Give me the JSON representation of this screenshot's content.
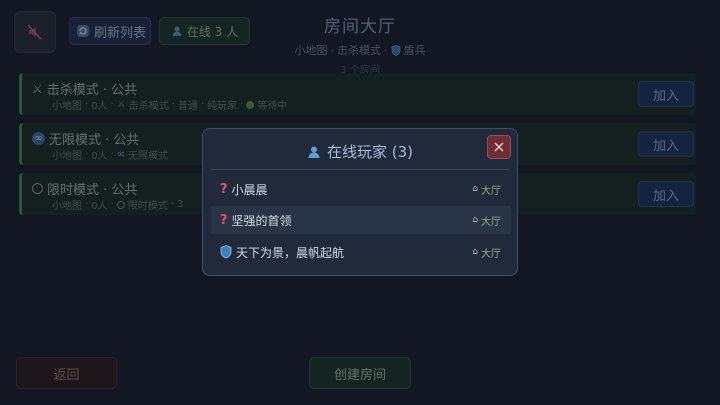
{
  "header": {
    "refresh_label": "刷新列表",
    "online_label": "在线 3 人",
    "title": "房间大厅",
    "sub_map": "小地图",
    "sub_mode": "击杀模式",
    "sub_role": "盾兵",
    "room_count": "3 个房间"
  },
  "rooms": [
    {
      "name": "击杀模式 · 公共",
      "map": "小地图",
      "players": "0人",
      "mode": "击杀模式",
      "difficulty": "普通",
      "type": "纯玩家",
      "status": "等待中",
      "join_label": "加入",
      "icon": "swords-icon"
    },
    {
      "name": "无限模式 · 公共",
      "map": "小地图",
      "players": "0人",
      "mode": "无限模式",
      "join_label": "加入",
      "icon": "infinity-icon"
    },
    {
      "name": "限时模式 · 公共",
      "map": "小地图",
      "players": "0人",
      "mode": "限时模式",
      "extra": "3",
      "join_label": "加入",
      "icon": "stopwatch-icon"
    }
  ],
  "modal": {
    "title": "在线玩家 (3)",
    "players": [
      {
        "name": "小晨晨",
        "location": "大厅",
        "icon": "question-icon"
      },
      {
        "name": "坚强的首领",
        "location": "大厅",
        "icon": "question-icon"
      },
      {
        "name": "天下为景，晨帆起航",
        "location": "大厅",
        "icon": "shield-icon"
      }
    ]
  },
  "footer": {
    "back_label": "返回",
    "create_label": "创建房间"
  },
  "colors": {
    "background": "#1a2130",
    "accent_green": "#3aa055",
    "join_blue": "#1e3a62",
    "close_red": "#6e2e35"
  }
}
